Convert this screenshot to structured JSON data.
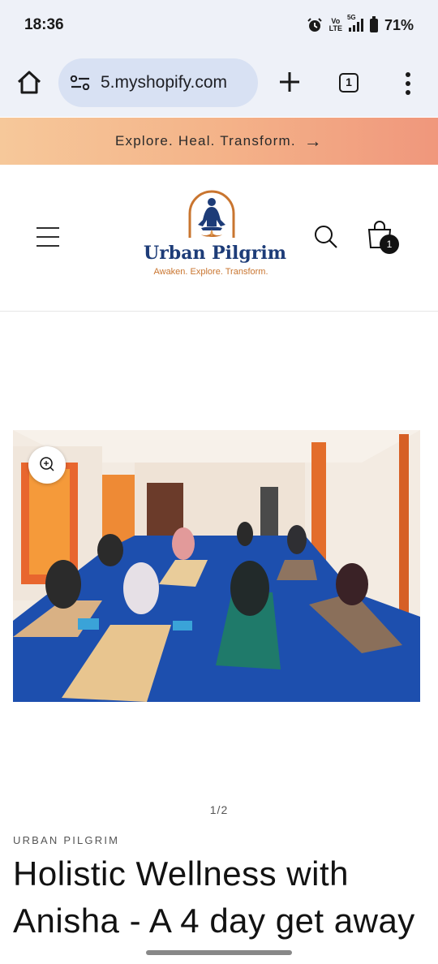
{
  "status_bar": {
    "time": "18:36",
    "network_tag": "5G",
    "volte_top": "Vo",
    "volte_bottom": "LTE",
    "battery": "71%"
  },
  "browser": {
    "url": "5.myshopify.com",
    "tab_count": "1",
    "icons": [
      "home-icon",
      "site-settings-icon",
      "new-tab-icon",
      "tab-switcher-icon",
      "overflow-menu-icon"
    ]
  },
  "announcement": {
    "text": "Explore. Heal. Transform.",
    "arrow": "→",
    "colors": [
      "#f6c89a",
      "#f0977c"
    ]
  },
  "header": {
    "logo_name": "Urban Pilgrim",
    "logo_tagline": "Awaken. Explore. Transform.",
    "cart_count": "1",
    "brand_color": "#1d3c78",
    "accent_color": "#c9752f"
  },
  "product": {
    "image_counter": "1/2",
    "vendor": "URBAN PILGRIM",
    "title": "Holistic Wellness with Anisha - A 4 day get away"
  }
}
